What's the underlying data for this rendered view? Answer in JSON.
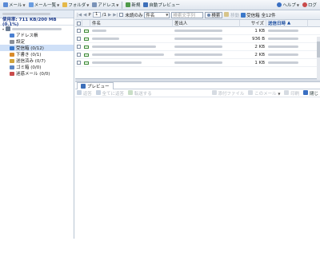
{
  "toolbar": {
    "mail": "メール",
    "mail_list": "メール一覧",
    "folder": "フォルダ",
    "address": "アドレス",
    "new": "新規",
    "auto_preview": "自動プレビュー",
    "help": "ヘルプ",
    "logout": "ログ"
  },
  "account": {
    "quota": "使用率: 711 KB/200 MB (0.1%)"
  },
  "folders": [
    {
      "label": "アドレス帳",
      "color": "#4a7fd1"
    },
    {
      "label": "設定",
      "color": "#8a8f98"
    },
    {
      "label": "受信箱 (0/12)",
      "color": "#3b78c9"
    },
    {
      "label": "下書き (0/1)",
      "color": "#d98b2b"
    },
    {
      "label": "送信済み (0/7)",
      "color": "#d0a33a"
    },
    {
      "label": "ゴミ箱 (0/0)",
      "color": "#5d86c4"
    },
    {
      "label": "迷惑メール (0/0)",
      "color": "#c94b4b"
    }
  ],
  "listbar": {
    "page_value": "1",
    "page_total": "/1",
    "unread_only": "未読のみ",
    "filter_select": "件名",
    "search_placeholder": "検索文字列",
    "search_button": "検索",
    "move_label": "移動",
    "folder_name": "受信箱",
    "count": "全12件"
  },
  "columns": {
    "subject": "件名",
    "from": "差出人",
    "size": "サイズ",
    "date": "送信日時"
  },
  "rows": [
    {
      "size": "1 KB"
    },
    {
      "size": "936 B"
    },
    {
      "size": "2 KB"
    },
    {
      "size": "2 KB"
    },
    {
      "size": "1 KB"
    }
  ],
  "preview": {
    "tab": "プレビュー",
    "reply": "返答",
    "reply_all": "全てに返答",
    "forward": "転送する",
    "attachments": "添付ファイル",
    "this_mail": "このメール",
    "print": "印刷",
    "close": "閉じ"
  },
  "colors": {
    "accent": "#1a4da0",
    "selected": "#cfe0f7",
    "toolbar_bg": "#dfe6ef"
  }
}
